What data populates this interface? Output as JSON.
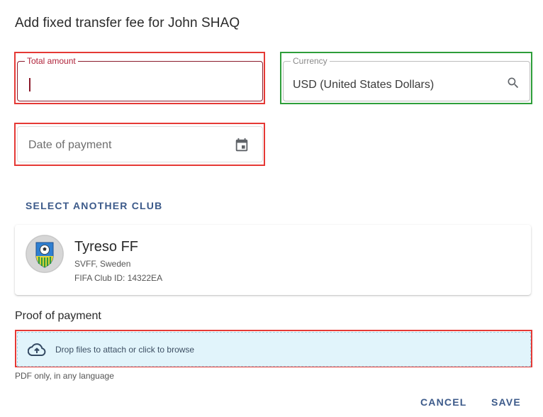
{
  "dialog": {
    "title": "Add fixed transfer fee for John SHAQ"
  },
  "fields": {
    "total_amount": {
      "label": "Total amount",
      "value": ""
    },
    "currency": {
      "label": "Currency",
      "value": "USD (United States Dollars)"
    },
    "date_of_payment": {
      "placeholder": "Date of payment"
    }
  },
  "club": {
    "select_another_label": "SELECT ANOTHER CLUB",
    "name": "Tyreso FF",
    "association": "SVFF, Sweden",
    "fifa_id": "FIFA Club ID: 14322EA"
  },
  "proof": {
    "label": "Proof of payment",
    "dropzone_text": "Drop files to attach or click to browse",
    "hint": "PDF only, in any language"
  },
  "actions": {
    "cancel": "CANCEL",
    "save": "SAVE"
  },
  "icons": {
    "currency_search": "search-icon",
    "date_picker": "calendar-icon",
    "upload": "cloud-upload-icon",
    "club_logo": "club-crest-icon"
  },
  "colors": {
    "accent_active": "#8b1a2b",
    "link": "#3c5a8a",
    "highlight_red": "#e53935",
    "highlight_green": "#2e9e3a",
    "dropzone_bg": "#e1f4fb"
  }
}
